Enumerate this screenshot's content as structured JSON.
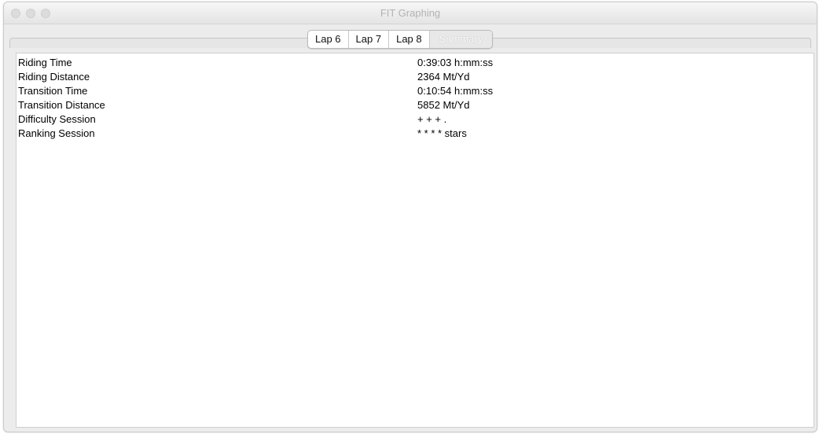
{
  "window": {
    "title": "FIT Graphing"
  },
  "tabs": [
    {
      "label": "Lap 6"
    },
    {
      "label": "Lap 7"
    },
    {
      "label": "Lap 8"
    },
    {
      "label": "Summary"
    }
  ],
  "selected_tab": "Summary",
  "summary": {
    "rows": [
      {
        "label": "Riding Time",
        "value": "0:39:03 h:mm:ss"
      },
      {
        "label": "Riding Distance",
        "value": "2364 Mt/Yd"
      },
      {
        "label": "Transition Time",
        "value": "0:10:54 h:mm:ss"
      },
      {
        "label": "Transition Distance",
        "value": "5852 Mt/Yd"
      },
      {
        "label": "Difficulty Session",
        "value": "+ + + ."
      },
      {
        "label": "Ranking Session",
        "value": "* * * * stars"
      }
    ]
  }
}
